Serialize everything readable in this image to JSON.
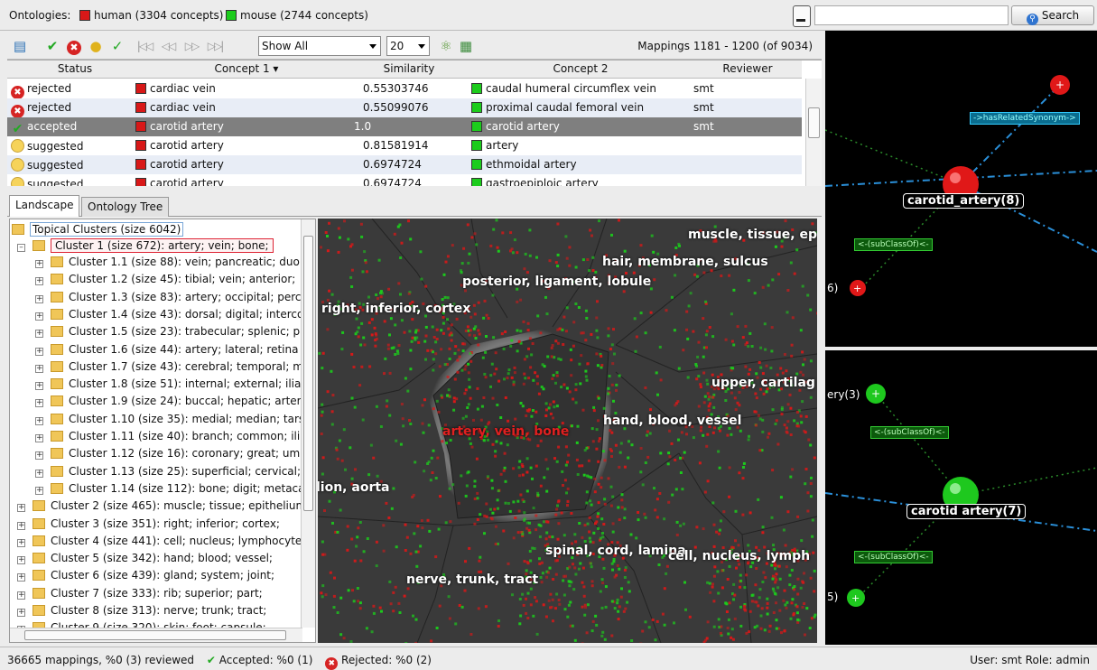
{
  "header": {
    "ontologies_label": "Ontologies:",
    "ontology_human": "human (3304 concepts)",
    "ontology_mouse": "mouse (2744 concepts)",
    "search_value": "",
    "search_button": "Search"
  },
  "toolbar": {
    "filter_value": "Show All",
    "page_size_value": "20",
    "mappings_range": "Mappings 1181 - 1200  (of 9034)"
  },
  "table": {
    "columns": [
      "Status",
      "Concept 1 ▾",
      "Similarity",
      "Concept 2",
      "Reviewer"
    ],
    "rows": [
      {
        "status": "rejected",
        "concept1": "cardiac vein",
        "similarity": "0.55303746",
        "concept2": "caudal humeral circumflex vein",
        "reviewer": "smt"
      },
      {
        "status": "rejected",
        "concept1": "cardiac vein",
        "similarity": "0.55099076",
        "concept2": "proximal caudal femoral vein",
        "reviewer": "smt"
      },
      {
        "status": "accepted",
        "concept1": "carotid artery",
        "similarity": "1.0",
        "concept2": "carotid artery",
        "reviewer": "smt"
      },
      {
        "status": "suggested",
        "concept1": "carotid artery",
        "similarity": "0.81581914",
        "concept2": "artery",
        "reviewer": ""
      },
      {
        "status": "suggested",
        "concept1": "carotid artery",
        "similarity": "0.6974724",
        "concept2": "ethmoidal artery",
        "reviewer": ""
      },
      {
        "status": "suggested",
        "concept1": "carotid artery",
        "similarity": "0.6974724",
        "concept2": "gastroepiploic artery",
        "reviewer": ""
      }
    ]
  },
  "tabs": [
    "Landscape",
    "Ontology Tree"
  ],
  "tree": {
    "root": "Topical Clusters (size 6042)",
    "cluster1": "Cluster 1 (size 672): artery; vein; bone;",
    "subclusters": [
      "Cluster 1.1 (size 88): vein; pancreatic; duo",
      "Cluster 1.2 (size 45): tibial; vein; anterior;",
      "Cluster 1.3 (size 83): artery; occipital; perc",
      "Cluster 1.4 (size 43): dorsal; digital; interco",
      "Cluster 1.5 (size 23): trabecular; splenic; p",
      "Cluster 1.6 (size 44): artery; lateral; retina",
      "Cluster 1.7 (size 43): cerebral; temporal; m",
      "Cluster 1.8 (size 51): internal; external; ilia",
      "Cluster 1.9 (size 24): buccal; hepatic; arter",
      "Cluster 1.10 (size 35): medial; median; tars",
      "Cluster 1.11 (size 40): branch; common; ilia",
      "Cluster 1.12 (size 16): coronary; great; um",
      "Cluster 1.13 (size 25): superficial; cervical;",
      "Cluster 1.14 (size 112): bone; digit; metaca"
    ],
    "clusters": [
      "Cluster 2 (size 465): muscle; tissue; epithelium;",
      "Cluster 3 (size 351): right; inferior; cortex;",
      "Cluster 4 (size 441): cell; nucleus; lymphocyte;",
      "Cluster 5 (size 342): hand; blood; vessel;",
      "Cluster 6 (size 439): gland; system; joint;",
      "Cluster 7 (size 333): rib; superior; part;",
      "Cluster 8 (size 313): nerve; trunk; tract;",
      "Cluster 9 (size 320): skin; foot; capsule;"
    ]
  },
  "landscape": {
    "labels": [
      "muscle, tissue, ep",
      "hair, membrane, sulcus",
      "posterior, ligament, lobule",
      "right, inferior, cortex",
      "upper, cartilag",
      "artery, vein, bone",
      "hand, blood, vessel",
      "lion, aorta",
      "spinal, cord, lamina",
      "cell, nucleus, lymph",
      "nerve, trunk, tract"
    ]
  },
  "graph_top": {
    "node": "carotid_artery(8)",
    "edge1": "->hasRelatedSynonym->",
    "edge2": "<-(subClassOf)<-",
    "fragment": "6)"
  },
  "graph_bottom": {
    "node": "carotid artery(7)",
    "edge1": "<-(subClassOf)<-",
    "edge2": "<-(subClassOf)<-",
    "fragment_top": "ery(3)",
    "fragment_bottom": "5)"
  },
  "status": {
    "summary": "36665 mappings, %0 (3) reviewed",
    "accepted": "Accepted: %0 (1)",
    "rejected": "Rejected: %0 (2)",
    "user": "User: smt   Role: admin"
  },
  "colors": {
    "human": "#d81818",
    "mouse": "#1ccc1c",
    "selected_row": "#7f7f7f",
    "landscape_bg": "#3a3a3a"
  }
}
